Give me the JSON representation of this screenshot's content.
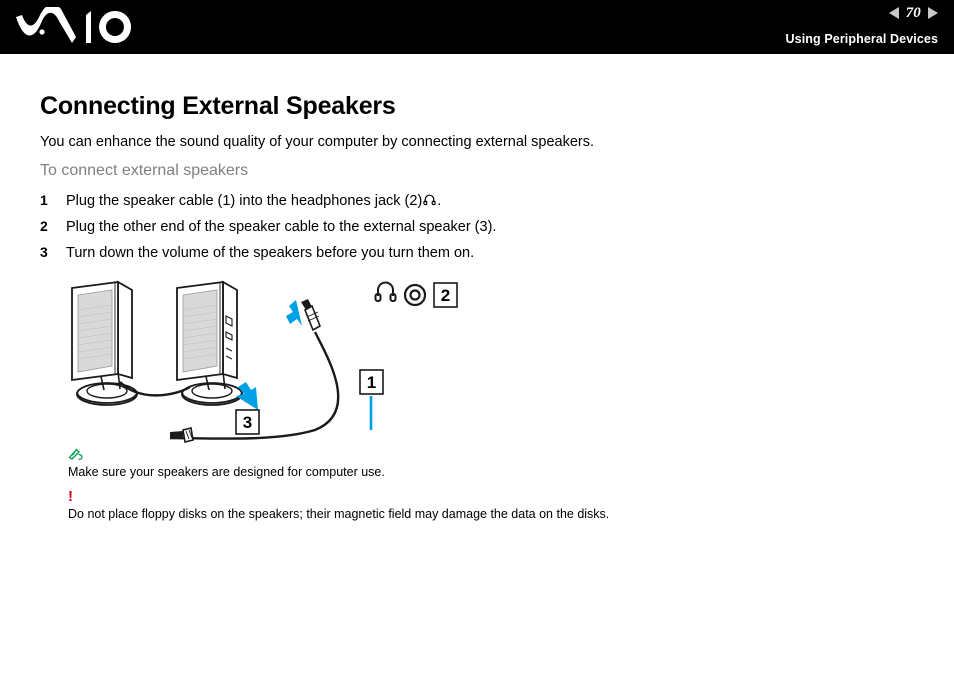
{
  "header": {
    "logo_alt": "VAIO",
    "page_number": "70",
    "prev_icon": "triangle-left-icon",
    "next_icon": "triangle-right-icon",
    "section_title": "Using Peripheral Devices",
    "background": "#000000"
  },
  "page": {
    "heading": "Connecting External Speakers",
    "intro": "You can enhance the sound quality of your computer by connecting external speakers.",
    "sub_heading": "To connect external speakers",
    "sub_heading_color": "#808080"
  },
  "steps": [
    {
      "num": "1",
      "text_before": "Plug the speaker cable (1) into the headphones jack (2)",
      "icon": "headphones-icon",
      "text_after": "."
    },
    {
      "num": "2",
      "text_before": "Plug the other end of the speaker cable to the external speaker (3).",
      "icon": "",
      "text_after": ""
    },
    {
      "num": "3",
      "text_before": "Turn down the volume of the speakers before you turn them on.",
      "icon": "",
      "text_after": ""
    }
  ],
  "figure": {
    "name": "external-speakers-connection-diagram",
    "callouts": [
      {
        "label": "1",
        "meaning": "speaker cable"
      },
      {
        "label": "2",
        "meaning": "headphones jack"
      },
      {
        "label": "3",
        "meaning": "external speaker"
      }
    ],
    "port_icons": [
      {
        "name": "headphones-icon"
      },
      {
        "name": "audio-jack-port-icon"
      }
    ],
    "accent_color": "#00A0E6",
    "line_color": "#1a1a1a",
    "speaker_fill": "#d9d9d9"
  },
  "notes": [
    {
      "icon": "pencil-note-icon",
      "icon_color": "#009b48",
      "text": "Make sure your speakers are designed for computer use."
    },
    {
      "icon": "exclamation-icon",
      "icon_color": "#d0021b",
      "text": "Do not place floppy disks on the speakers; their magnetic field may damage the data on the disks."
    }
  ]
}
